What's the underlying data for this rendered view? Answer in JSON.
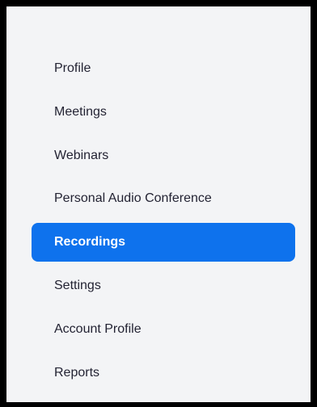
{
  "sidebar": {
    "active_color": "#0e72ed",
    "items": [
      {
        "label": "Profile",
        "active": false
      },
      {
        "label": "Meetings",
        "active": false
      },
      {
        "label": "Webinars",
        "active": false
      },
      {
        "label": "Personal Audio Conference",
        "active": false
      },
      {
        "label": "Recordings",
        "active": true
      },
      {
        "label": "Settings",
        "active": false
      },
      {
        "label": "Account Profile",
        "active": false
      },
      {
        "label": "Reports",
        "active": false
      }
    ]
  }
}
